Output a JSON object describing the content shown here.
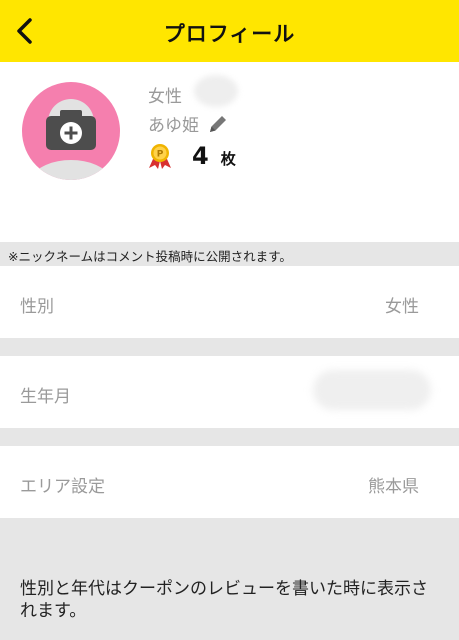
{
  "header": {
    "title": "プロフィール",
    "back_icon": "chevron-left-icon",
    "background_color": "#ffe600"
  },
  "profile": {
    "avatar_color": "#f57fae",
    "avatar_icon": "add-photo-icon",
    "gender": "女性",
    "nickname": "あゆ姫",
    "edit_icon": "pencil-icon",
    "coupon_icon": "medal-icon",
    "coupon_count": "4",
    "coupon_unit": "枚"
  },
  "notice": "※ニックネームはコメント投稿時に公開されます。",
  "fields": [
    {
      "label": "性別",
      "value": "女性"
    },
    {
      "label": "生年月",
      "value": ""
    },
    {
      "label": "エリア設定",
      "value": "熊本県"
    }
  ],
  "footer_note": "性別と年代はクーポンのレビューを書いた時に表示されます。"
}
